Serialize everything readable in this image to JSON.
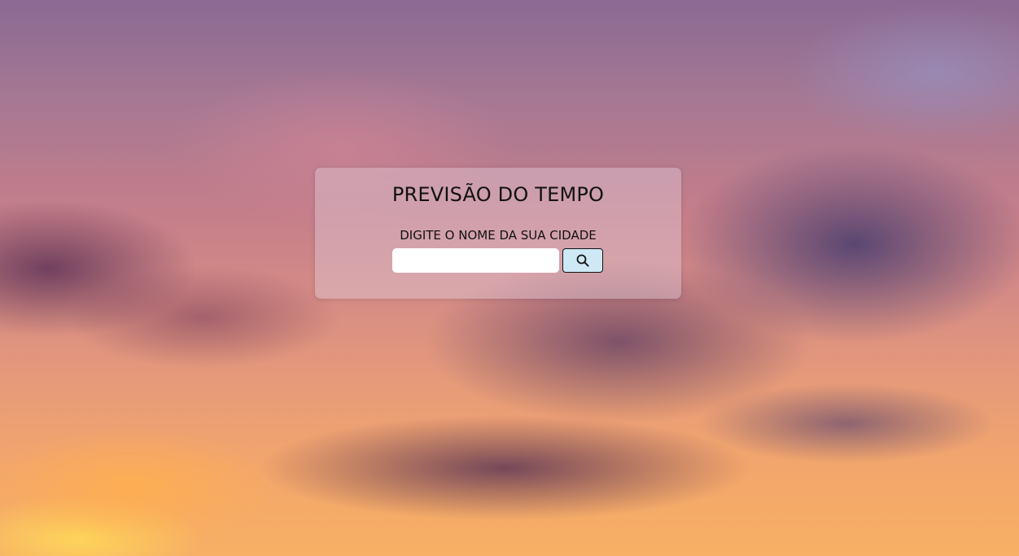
{
  "app": {
    "title": "PREVISÃO DO TEMPO"
  },
  "search": {
    "prompt": "DIGITE O NOME DA SUA CIDADE",
    "value": "",
    "placeholder": "",
    "button_icon": "search-icon"
  },
  "colors": {
    "card_background": "#e1cddc",
    "button_background": "#cfe8f5",
    "text": "#111111"
  }
}
